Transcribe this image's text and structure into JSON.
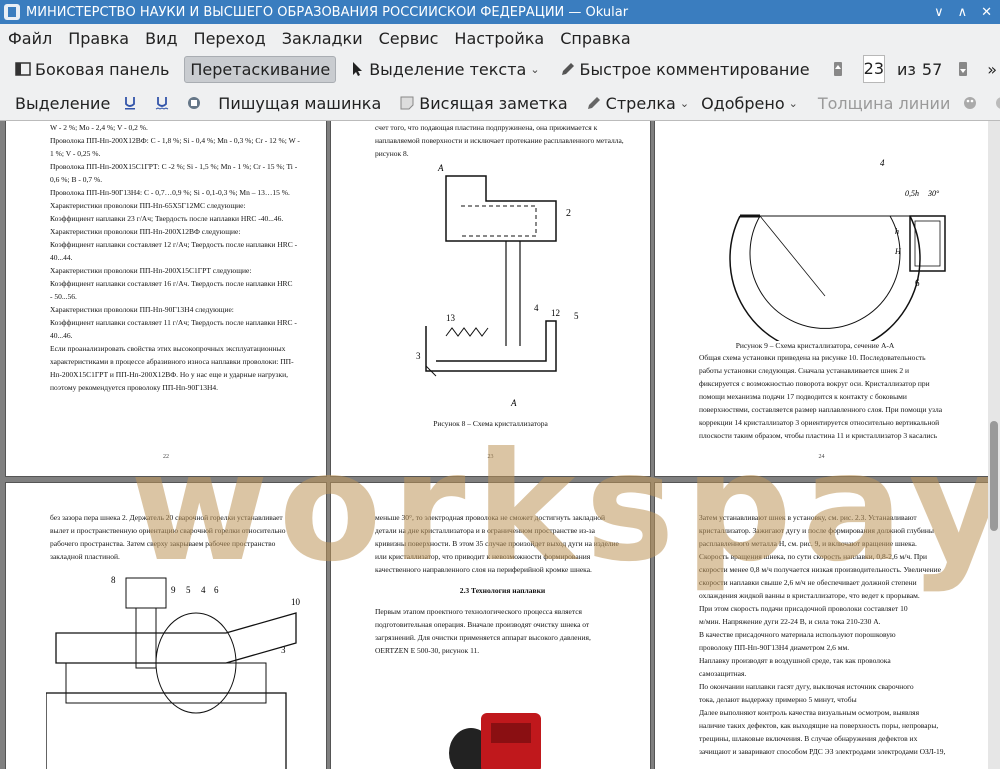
{
  "window": {
    "title": "МИНИСТЕРСТВО НАУКИ И ВЫСШЕГО ОБРАЗОВАНИЯ  РОССИЙСКОЙ ФЕДЕРАЦИИ  — Okular",
    "controls": [
      "∨",
      "∧",
      "✕"
    ]
  },
  "menu": [
    "Файл",
    "Правка",
    "Вид",
    "Переход",
    "Закладки",
    "Сервис",
    "Настройка",
    "Справка"
  ],
  "toolbar1": {
    "sidebar_label": "Боковая панель",
    "drag_label": "Перетаскивание",
    "text_select_label": "Выделение текста",
    "quick_comment_label": "Быстрое комментирование",
    "current_page": "23",
    "of_label": "из",
    "total_pages": "57"
  },
  "toolbar2": {
    "highlight_label": "Выделение",
    "typewriter_label": "Пишущая машинка",
    "note_label": "Висящая заметка",
    "arrow_label": "Стрелка",
    "stamp_label": "Одобрено",
    "line_width_label": "Толщина линии"
  },
  "watermark": "workspay",
  "pages": {
    "p22": {
      "lines": [
        "W - 2 %; Mo - 2,4 %; V - 0,2 %.",
        "Проволока ПП-Нп-200Х12ВФ: С - 1,8 %; Si - 0,4 %; Mn - 0,3 %; Cr - 12 %; W -",
        "1 %; V - 0,25 %.",
        "Проволока ПП-Нп-200Х15С1ГРТ: С -2 %; Si - 1,5 %; Mn - 1 %; Cr - 15 %; Ti -",
        "0,6 %;  В - 0,7 %.",
        "Проволока ПП-Нп-90Г13Н4: С  - 0,7…0,9 %;  Si - 0,1-0,3 %; Mn – 13…15 %.",
        "Характеристики   проволоки   ПП-Нп-65Х5Г12МС   следующие:",
        "Коэффициент наплавки 23 г/Ач; Твердость после наплавки HRC -40...46.",
        "Характеристики   проволоки   ПП-Нп-200Х12ВФ   следующие:",
        "Коэффициент наплавки составляет  12 г/Ач; Твердость после наплавки HRC -",
        "40...44.",
        "Характеристики   проволоки   ПП-Нп-200Х15С1ГРТ   следующие:",
        "Коэффициент наплавки составляет  16 г/Ач.   Твердость после наплавки HRC",
        "- 50...56.",
        "Характеристики   проволоки   ПП-Нп-90Г13Н4   следующие:",
        "Коэффициент наплавки составляет 11 г/Ач;  Твердость после наплавки HRC -",
        "40...46.",
        "Если    проанализировать   свойства   этих    высокопрочных    эксплуатационных",
        "характеристиками в процессе абразивного износа наплавки проволоки: ПП-",
        "Нп-200Х15С1ГРТ и ПП-Нп-200Х12ВФ. Но у нас еще и ударные нагрузки,",
        "поэтому рекомендуется проволоку ПП-Нп-90Г13Н4."
      ],
      "number": "22"
    },
    "p23": {
      "lines": [
        "счет того, что подающая пластина подпружинена, она прижимается к",
        "наплавляемой поверхности и исключает протекание расплавленного металла,",
        "рисунок 8."
      ],
      "caption": "Рисунок 8 – Схема кристаллизатора",
      "number": "23",
      "labels": [
        "А",
        "2",
        "13",
        "4",
        "12",
        "5",
        "3",
        "А"
      ]
    },
    "p24": {
      "caption": "Рисунок 9 – Схема кристаллизатора, сечение А-А",
      "lines": [
        "Общая схема установки приведена на рисунке 10. Последовательность",
        "работы  установки  следующая.  Сначала  устанавливается  шнек  2  и",
        "фиксируется с возможностью поворота вокруг оси.  Кристаллизатор при",
        "помощи  механизма  подачи  17  подводится  к  контакту  с  боковыми",
        "поверхностями, составляется размер наплавленного слоя. При помощи узла",
        "коррекции 14 кристаллизатор 3 ориентируется относительно вертикальной",
        "плоскости таким образом, чтобы  пластина 11 и кристаллизатор 3 касались"
      ],
      "number": "24",
      "labels": [
        "4",
        "0,5h",
        "30°",
        "6",
        "h",
        "H"
      ]
    },
    "p25": {
      "lines": [
        "без зазора пера шнека 2. Держатель 20 сварочной горелки устанавливает",
        "вылет и пространственную ориентацию сварочной горелки относительно",
        "рабочего пространства.  Затем сверху закрываем рабочее пространство",
        "закладной пластиной."
      ],
      "labels": [
        "8",
        "9",
        "5",
        "4",
        "6",
        "10",
        "3"
      ]
    },
    "p26": {
      "lines": [
        "меньше 30°, то электродная проволока не сможет достигнуть закладной",
        "детали на дне кристаллизатора и в ограниченном пространстве из-за",
        "кривизны поверхности. В этом 35 случае произойдет выход дуги на изделие",
        "или  кристаллизатор,  что  приводит  к  невозможности  формирования",
        "качественного направленного слоя на периферийной кромке шнека."
      ],
      "heading": "2.3 Технология наплавки",
      "lines2": [
        "Первым   этапом   проектного   технологического   процесса   является",
        "подготовительная  операция.    Вначале  производят  очистку  шнека  от",
        "загрязнений.    Для  очистки  применяется  аппарат  высокого  давления,",
        "OERTZEN E 500-30, рисунок 11."
      ]
    },
    "p27": {
      "lines": [
        "Затем устанавливают шнек в установку, см. рис. 2.3. Устанавливают",
        "кристаллизатор.  Зажигают дугу и после формирования должной глубины",
        "расплавленного металла H, см. рис. 9, и включают вращение шнека.",
        "Скорость вращения шнека, по сути скорость наплавки, 0,8-2,6 м/ч. При",
        "скорости менее 0,8 м/ч получается низкая производительность. Увеличение",
        "скорости   наплавки   свыше   2,6   м/ч   не   обеспечивает   должной   степени",
        "охлаждения жидкой ванны в кристаллизаторе, что ведет к прорывам.",
        "При  этом  скорость  подачи  присадочной  проволоки  составляет  10",
        "м/мин. Напряжение дуги 22-24 В, и сила тока 210-230 А.",
        "В   качестве   присадочного   материала   используют   порошковую",
        "проволоку ПП-Нп-90Г13Н4 диаметром 2,6 мм.",
        "Наплавку  производят  в  воздушной  среде,  так  как  проволока",
        "самозащитная.",
        "По окончании наплавки гасят дугу, выключая источник сварочного",
        "тока, делают выдержку примерно 5 минут, чтобы",
        "Далее выполняют контроль качества визуальным осмотром, выявляя",
        "наличие таких дефектов, как выходящие на поверхность поры, непровары,",
        "трещины,  шлаковые  включения.  В  случае  обнаружения  дефектов  их",
        "зачищают и заваривают способом РДС ЭЗ электродами электродами ОЗЛ-19,"
      ]
    }
  }
}
